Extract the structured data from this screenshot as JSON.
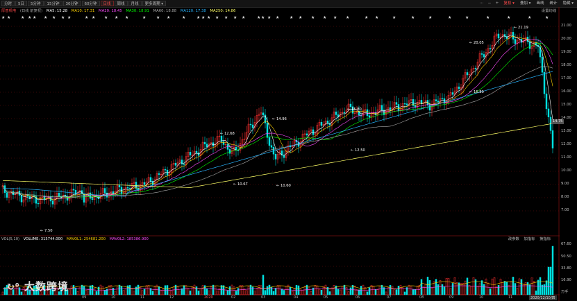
{
  "toolbar": {
    "periods": [
      "分时",
      "5日",
      "5分钟",
      "15分钟",
      "30分钟",
      "60分钟",
      "日线",
      "周线",
      "月线",
      "更多周期 ▾"
    ],
    "active_period": "日线",
    "right_items": [
      "复权 ▾",
      "叠加 ▾",
      "画线",
      "统计",
      "隐藏 ▾"
    ],
    "right_active": "复权 ▾"
  },
  "stock": {
    "name": "厚普机电",
    "mode": "(日线 前复权)",
    "ma_settings_label": "设置均线"
  },
  "ma_lines": [
    {
      "label": "MA5: 15.28",
      "color": "#ffffff"
    },
    {
      "label": "MA10: 17.31",
      "color": "#ffd200"
    },
    {
      "label": "MA20: 18.45",
      "color": "#ff4cff"
    },
    {
      "label": "MA30: 18.91",
      "color": "#00ff00"
    },
    {
      "label": "MA60: 18.88",
      "color": "#aaaaaa"
    },
    {
      "label": "MA120: 17.38",
      "color": "#28b4ff"
    },
    {
      "label": "MA250: 14.86",
      "color": "#ffff66"
    }
  ],
  "price_axis": [
    "21.00",
    "20.00",
    "19.00",
    "18.00",
    "17.00",
    "16.00",
    "15.00",
    "14.00",
    "13.00",
    "12.00",
    "11.00",
    "10.00",
    "9.00",
    "8.00",
    "7.00"
  ],
  "price_badge": "14.75",
  "annotations": [
    {
      "text": "21.19",
      "color": "#ffffff"
    },
    {
      "text": "20.05",
      "color": "#ffffff"
    },
    {
      "text": "16.80",
      "color": "#ffffff"
    },
    {
      "text": "15.80",
      "color": "#ffffff"
    },
    {
      "text": "14.96",
      "color": "#ffffff"
    },
    {
      "text": "12.50",
      "color": "#ffffff"
    },
    {
      "text": "12.68",
      "color": "#ffffff"
    },
    {
      "text": "10.67",
      "color": "#ffffff"
    },
    {
      "text": "10.60",
      "color": "#ffffff"
    },
    {
      "text": "7.50",
      "color": "#ffffff"
    }
  ],
  "volume": {
    "title": "VOL(5,10)",
    "volume_label": "VOLUME: 315744.000",
    "mavol1_label": "MAVOL1: 254681.200",
    "mavol2_label": "MAVOL2: 185386.900",
    "axis": [
      "67.60",
      "50.50",
      "33.80",
      "16.90",
      "万手"
    ],
    "panel_buttons": [
      "改参数",
      "加指标",
      "换指标"
    ]
  },
  "xaxis": [
    "09",
    "10",
    "11",
    "12",
    "2020",
    "02",
    "03",
    "04",
    "05",
    "06",
    "07",
    "08",
    "09",
    "10",
    "11",
    "2020/12/10/四"
  ],
  "watermark": "大数跨境",
  "colors": {
    "up": "#ff3030",
    "down": "#00e0e0",
    "ma5": "#ffffff",
    "ma10": "#ffd200",
    "ma20": "#ff4cff",
    "ma30": "#00ff00",
    "ma60": "#aaaaaa",
    "ma120": "#28b4ff",
    "ma250": "#ffff66"
  }
}
